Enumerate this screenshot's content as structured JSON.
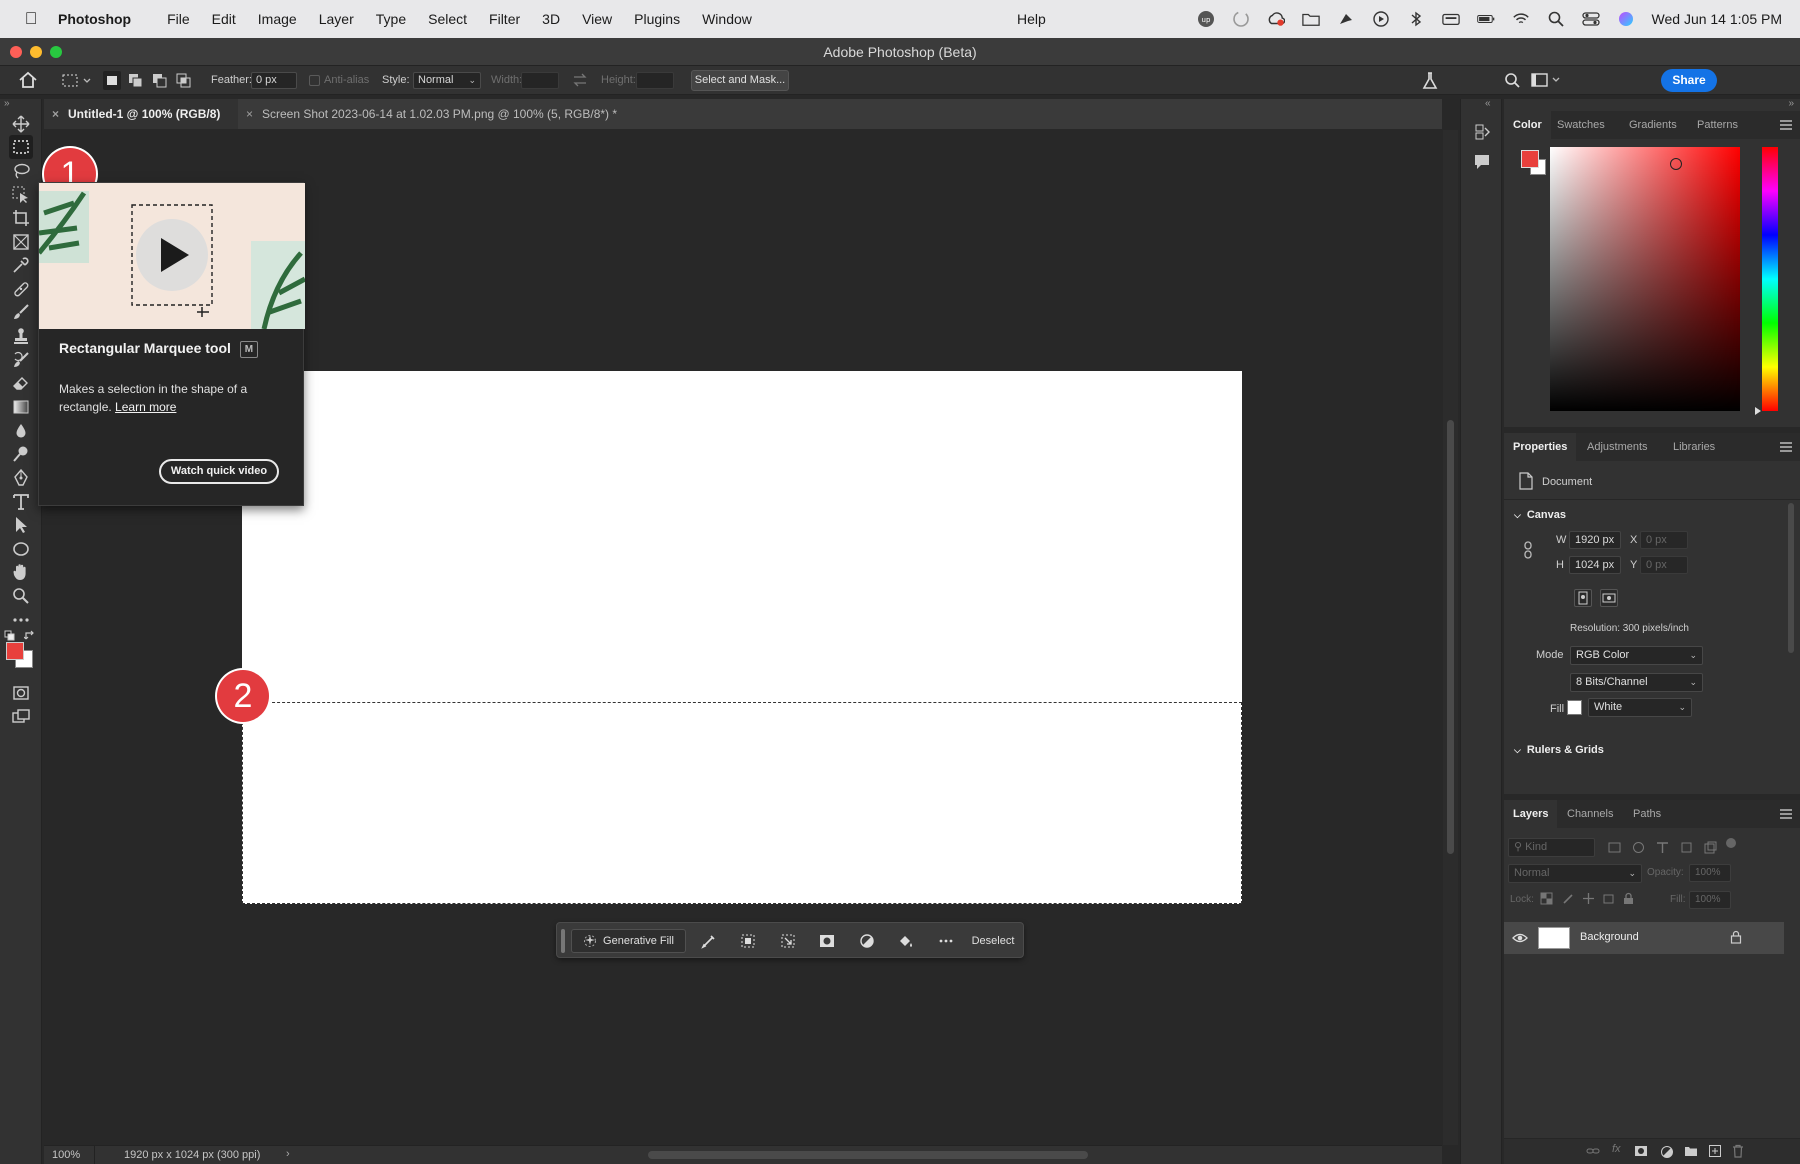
{
  "menubar": {
    "app_name": "Photoshop",
    "items": [
      "File",
      "Edit",
      "Image",
      "Layer",
      "Type",
      "Select",
      "Filter",
      "3D",
      "View",
      "Plugins",
      "Window"
    ],
    "help": "Help",
    "clock": "Wed Jun 14  1:05 PM"
  },
  "window": {
    "title": "Adobe Photoshop (Beta)"
  },
  "options_bar": {
    "feather_label": "Feather:",
    "feather_value": "0 px",
    "anti_alias_label": "Anti-alias",
    "style_label": "Style:",
    "style_value": "Normal",
    "width_label": "Width:",
    "height_label": "Height:",
    "select_mask_label": "Select and Mask...",
    "share_label": "Share"
  },
  "tabs": [
    {
      "label": "Untitled-1 @ 100% (RGB/8)",
      "active": true
    },
    {
      "label": "Screen Shot 2023-06-14 at 1.02.03 PM.png @ 100% (5, RGB/8*) *",
      "active": false
    }
  ],
  "tooltip": {
    "title": "Rectangular Marquee tool",
    "shortcut": "M",
    "description": "Makes a selection in the shape of a rectangle.",
    "learn_more": "Learn more",
    "watch_video": "Watch quick video"
  },
  "markers": [
    "1",
    "2"
  ],
  "taskbar": {
    "generative_fill": "Generative Fill",
    "deselect": "Deselect"
  },
  "status": {
    "zoom": "100%",
    "doc_info": "1920 px x 1024 px (300 ppi)"
  },
  "color_panel": {
    "tabs": [
      "Color",
      "Swatches",
      "Gradients",
      "Patterns"
    ],
    "foreground": "#e8403c",
    "background": "#ffffff",
    "hue": "#ff0000"
  },
  "properties_panel": {
    "tabs": [
      "Properties",
      "Adjustments",
      "Libraries"
    ],
    "document_label": "Document",
    "canvas_header": "Canvas",
    "w_label": "W",
    "w_value": "1920 px",
    "h_label": "H",
    "h_value": "1024 px",
    "x_label": "X",
    "x_value": "0 px",
    "y_label": "Y",
    "y_value": "0 px",
    "resolution": "Resolution: 300 pixels/inch",
    "mode_label": "Mode",
    "mode_value": "RGB Color",
    "bits_value": "8 Bits/Channel",
    "fill_label": "Fill",
    "fill_value": "White",
    "rulers_header": "Rulers & Grids"
  },
  "layers_panel": {
    "tabs": [
      "Layers",
      "Channels",
      "Paths"
    ],
    "kind_placeholder": "Kind",
    "blend_mode": "Normal",
    "opacity_label": "Opacity:",
    "opacity_value": "100%",
    "lock_label": "Lock:",
    "fill_label": "Fill:",
    "fill_value": "100%",
    "layers": [
      {
        "name": "Background",
        "visible": true,
        "locked": true
      }
    ]
  }
}
